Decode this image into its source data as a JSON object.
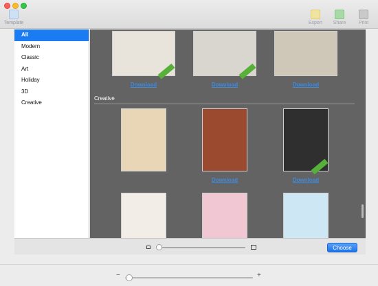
{
  "toolbar": {
    "template_label": "Template",
    "export_label": "Export",
    "share_label": "Share",
    "print_label": "Print"
  },
  "sidebar": {
    "items": [
      {
        "label": "All",
        "selected": true
      },
      {
        "label": "Modern"
      },
      {
        "label": "Classic"
      },
      {
        "label": "Art"
      },
      {
        "label": "Holiday"
      },
      {
        "label": "3D"
      },
      {
        "label": "Creative"
      }
    ]
  },
  "content": {
    "top_row_downloads": [
      "Download",
      "Download",
      "Download"
    ],
    "section_title": "Creative",
    "creative_row_downloads": [
      "Download",
      "Download"
    ],
    "tile_colors": {
      "tile1": "#e8e4dc",
      "tile2": "#d9d6cf",
      "tile3": "#cfc7b8",
      "tile4": "#e9d6b7",
      "tile5": "#9b4a2f",
      "tile6": "#2f2f2f",
      "tile7": "#f2ede6",
      "tile8": "#f0c7d2",
      "tile9": "#cde7f4"
    }
  },
  "sheet_bottom": {
    "choose_label": "Choose",
    "thumbnail_size_level": 0.0
  },
  "footer": {
    "minus_symbol": "−",
    "plus_symbol": "+",
    "zoom_level": 0.0
  }
}
